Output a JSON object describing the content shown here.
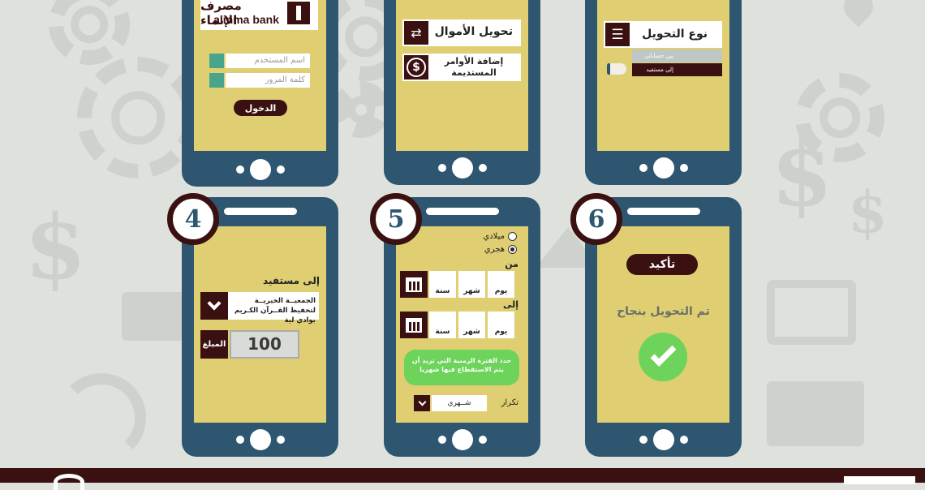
{
  "bank": {
    "arabic_name": "مصرف الإنماء",
    "english_name": "alinma bank"
  },
  "login": {
    "username_placeholder": "اسم المستخدم",
    "password_placeholder": "كلمة المرور",
    "login_button": "الدخول"
  },
  "menu": {
    "transfer_funds": "تحويل الأموال",
    "standing_orders": "إضافة الأوامر المستديمة"
  },
  "transfer_type": {
    "title": "نوع التحويل",
    "option_between_accounts": "بين حساباتي",
    "option_to_beneficiary": "إلى مستفيد"
  },
  "beneficiary": {
    "label": "إلى مستفيد",
    "selected": "الجمعيــة الخيريــة لتحفيظ القــرآن الكـريم بوادي لية",
    "amount_label": "المبلغ",
    "amount_value": "100"
  },
  "schedule": {
    "gregorian": "ميلادي",
    "hijri": "هجري",
    "from_label": "من",
    "to_label": "إلى",
    "day": "يوم",
    "month": "شهر",
    "year": "سنة",
    "tooltip": "حدد الفترة الزمنية التي تريد أن يتم الاستقطاع فيها شهريا",
    "repeat_label": "تكرار",
    "repeat_value": "شــهري"
  },
  "confirm": {
    "button": "تأكيد",
    "success": "تم التحويل بنجاح"
  },
  "steps": [
    "4",
    "5",
    "6"
  ],
  "colors": {
    "phone": "#2e5670",
    "screen": "#dfcf72",
    "dark": "#3a1010",
    "success": "#6dd35a"
  }
}
